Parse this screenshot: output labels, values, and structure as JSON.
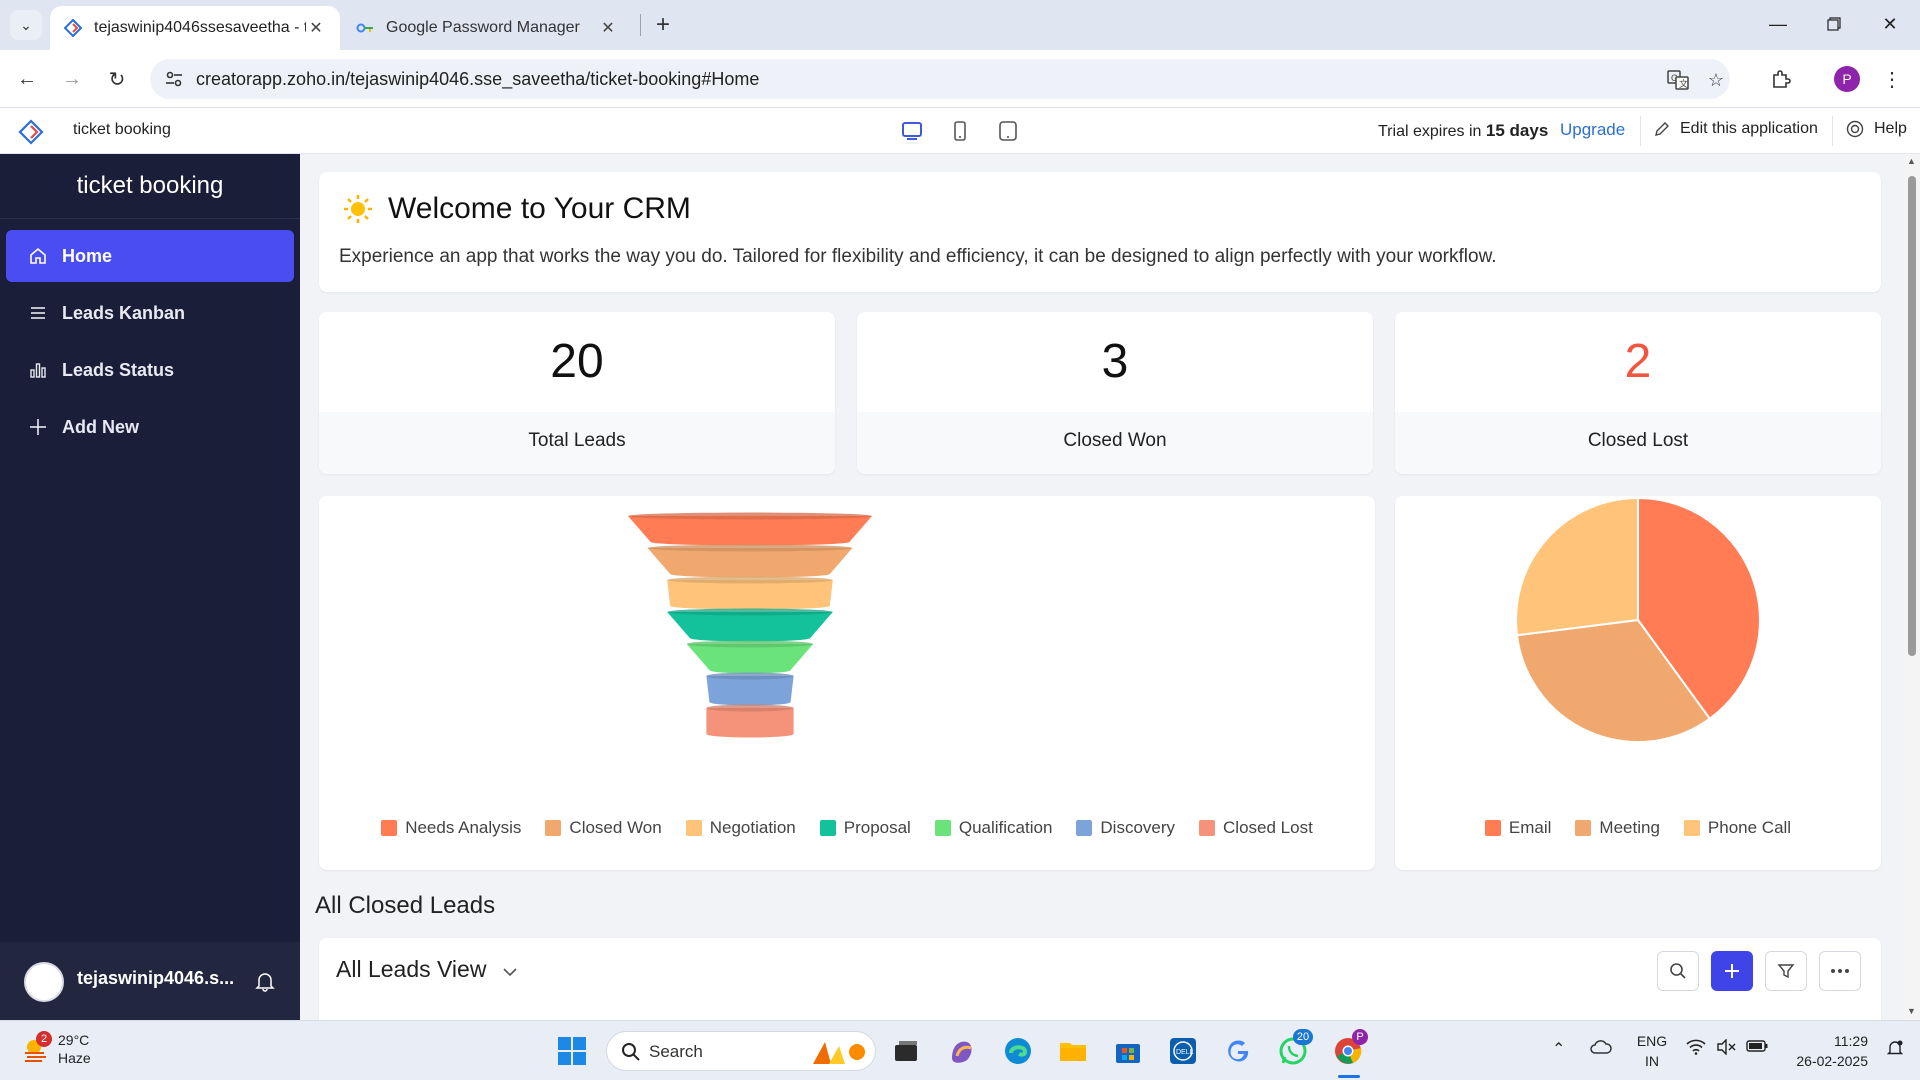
{
  "browser": {
    "tabs": [
      {
        "title": "tejaswinip4046ssesaveetha - ti",
        "active": true
      },
      {
        "title": "Google Password Manager",
        "active": false
      }
    ],
    "url": "creatorapp.zoho.in/tejaswinip4046.sse_saveetha/ticket-booking#Home",
    "profile_initial": "P"
  },
  "appbar": {
    "app_name": "ticket booking",
    "trial_prefix": "Trial expires in",
    "trial_days": "15 days",
    "upgrade": "Upgrade",
    "edit_app": "Edit this application",
    "help": "Help"
  },
  "sidebar": {
    "title": "ticket booking",
    "items": [
      {
        "label": "Home",
        "icon": "home-icon"
      },
      {
        "label": "Leads Kanban",
        "icon": "list-icon"
      },
      {
        "label": "Leads Status",
        "icon": "bar-chart-icon"
      },
      {
        "label": "Add New",
        "icon": "plus-icon"
      }
    ],
    "user": "tejaswinip4046.s..."
  },
  "welcome": {
    "title": "Welcome to Your CRM",
    "text": "Experience an app that works the way you do. Tailored for flexibility and efficiency, it can be designed to align perfectly with your workflow."
  },
  "stats": [
    {
      "value": "20",
      "label": "Total Leads",
      "color": "#111111"
    },
    {
      "value": "3",
      "label": "Closed Won",
      "color": "#111111"
    },
    {
      "value": "2",
      "label": "Closed Lost",
      "color": "#f2553f"
    }
  ],
  "chart_data": [
    {
      "type": "funnel",
      "categories": [
        "Needs Analysis",
        "Closed Won",
        "Negotiation",
        "Proposal",
        "Qualification",
        "Discovery",
        "Closed Lost"
      ],
      "colors": [
        "#ff7c55",
        "#f0a86e",
        "#ffc37a",
        "#13c29b",
        "#6ae37a",
        "#7da4da",
        "#f5927a"
      ],
      "values": [
        5,
        4,
        3,
        3,
        2,
        1,
        1
      ],
      "legend": "bottom"
    },
    {
      "type": "pie",
      "categories": [
        "Email",
        "Meeting",
        "Phone Call"
      ],
      "colors": [
        "#ff7c55",
        "#f0a86e",
        "#ffc37a"
      ],
      "values": [
        40,
        33,
        27
      ],
      "legend": "bottom"
    }
  ],
  "section": {
    "title": "All Closed Leads",
    "view_name": "All Leads View"
  },
  "taskbar": {
    "weather_temp": "29°C",
    "weather_desc": "Haze",
    "weather_badge": "2",
    "search_label": "Search",
    "whatsapp_badge": "20",
    "lang_line1": "ENG",
    "lang_line2": "IN",
    "time": "11:29",
    "date": "26-02-2025"
  }
}
